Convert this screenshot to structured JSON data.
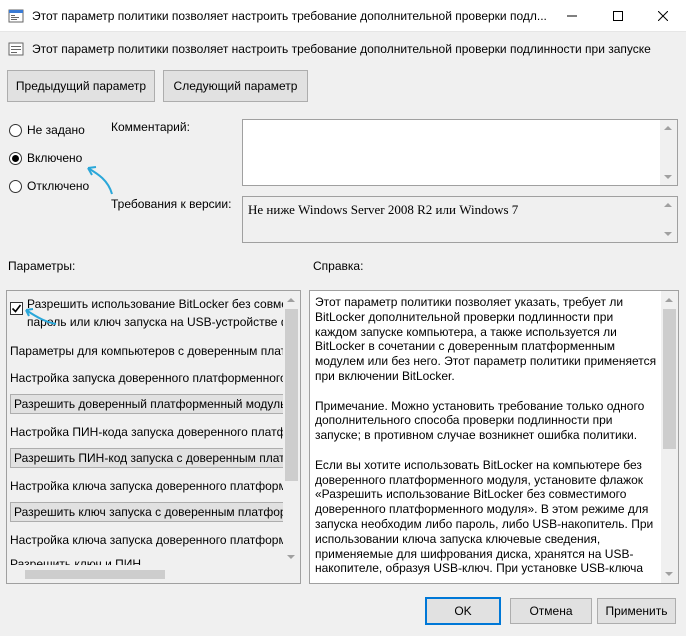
{
  "window": {
    "title": "Этот параметр политики позволяет настроить требование дополнительной проверки подл...",
    "minimize_icon": "minimize-icon",
    "maximize_icon": "maximize-icon",
    "close_icon": "close-icon"
  },
  "header": {
    "setting_name": "Этот параметр политики позволяет настроить требование дополнительной проверки подлинности при запуске"
  },
  "nav": {
    "prev_label": "Предыдущий параметр",
    "next_label": "Следующий параметр"
  },
  "state": {
    "options": [
      {
        "label": "Не задано",
        "checked": false
      },
      {
        "label": "Включено",
        "checked": true
      },
      {
        "label": "Отключено",
        "checked": false
      }
    ]
  },
  "comment": {
    "label": "Комментарий:",
    "value": ""
  },
  "supported": {
    "label": "Требования к версии:",
    "value": "Не ниже Windows Server 2008 R2 или Windows 7"
  },
  "options_section": {
    "title": "Параметры:",
    "checkbox_line1": "Разрешить использование BitLocker без совместимого",
    "checkbox_line2": "пароль или ключ запуска на USB-устройстве флэш",
    "items": [
      {
        "type": "text",
        "text": "Параметры для компьютеров с доверенным платформенным модулем"
      },
      {
        "type": "text",
        "text": "Настройка запуска доверенного платформенного модуля"
      },
      {
        "type": "select",
        "text": "Разрешить доверенный платформенный модуль"
      },
      {
        "type": "text",
        "text": "Настройка ПИН-кода запуска доверенного платформенного модуля"
      },
      {
        "type": "select",
        "text": "Разрешить ПИН-код запуска с доверенным платформенным модулем"
      },
      {
        "type": "text",
        "text": "Настройка ключа запуска доверенного платформенного модуля"
      },
      {
        "type": "select",
        "text": "Разрешить ключ запуска с доверенным платформенным модулем"
      },
      {
        "type": "text",
        "text": "Настройка ключа запуска доверенного платформенного модуля"
      },
      {
        "type": "text",
        "text": "Разрешить ключ и ПИН"
      }
    ]
  },
  "help_section": {
    "title": "Справка:",
    "text": "Этот параметр политики позволяет указать, требует ли\nBitLocker дополнительной проверки подлинности при\nкаждом запуске компьютера, а также используется ли\nBitLocker в сочетании с доверенным платформенным\nмодулем или без него. Этот параметр политики применяется\nпри включении BitLocker.\n\nПримечание. Можно установить требование только одного\nдополнительного способа проверки подлинности при\nзапуске; в противном случае возникнет ошибка политики.\n\nЕсли вы хотите использовать BitLocker на компьютере без\nдоверенного платформенного модуля, установите флажок\n«Разрешить использование BitLocker без совместимого\nдоверенного платформенного модуля». В этом режиме для\nзапуска необходим либо пароль, либо USB-накопитель. При\nиспользовании ключа запуска ключевые сведения,\nприменяемые для шифрования диска, хранятся на USB-\nнакопителе, образуя USB-ключ. При установке USB-ключа"
  },
  "footer": {
    "ok_label": "OK",
    "cancel_label": "Отмена",
    "apply_label": "Применить"
  },
  "colors": {
    "accent": "#0078d7",
    "annotation_arrow": "#2aa7d9"
  }
}
